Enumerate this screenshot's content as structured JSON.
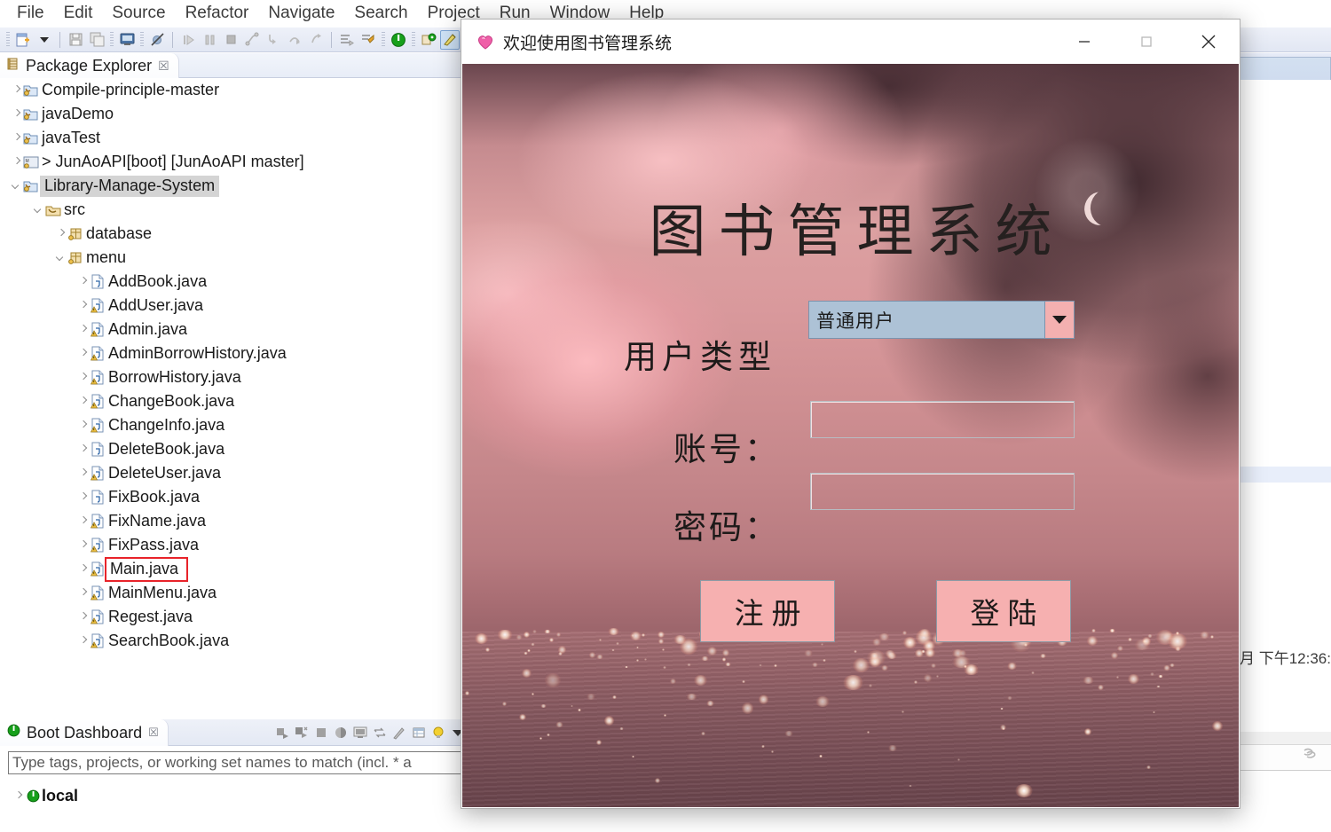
{
  "ide": {
    "menu": [
      "File",
      "Edit",
      "Source",
      "Refactor",
      "Navigate",
      "Search",
      "Project",
      "Run",
      "Window",
      "Help"
    ],
    "package_explorer": {
      "title": "Package Explorer",
      "close_label": "☒",
      "tree": [
        {
          "label": "Compile-principle-master",
          "indent": 0,
          "state": "collapsed",
          "icon": "java-project-icon",
          "selected": false
        },
        {
          "label": "javaDemo",
          "indent": 0,
          "state": "collapsed",
          "icon": "java-project-icon",
          "selected": false
        },
        {
          "label": "javaTest",
          "indent": 0,
          "state": "collapsed",
          "icon": "java-project-icon",
          "selected": false
        },
        {
          "label": "> JunAoAPI ",
          "dim": "[boot] [JunAoAPI master]",
          "indent": 0,
          "state": "collapsed",
          "icon": "maven-project-icon",
          "selected": false
        },
        {
          "label": "Library-Manage-System",
          "indent": 0,
          "state": "expanded",
          "icon": "java-project-icon",
          "selected": true
        },
        {
          "label": "src",
          "indent": 1,
          "state": "expanded",
          "icon": "source-folder-icon",
          "selected": false
        },
        {
          "label": "database",
          "indent": 2,
          "state": "collapsed",
          "icon": "package-icon",
          "selected": false
        },
        {
          "label": "menu",
          "indent": 2,
          "state": "expanded",
          "icon": "package-icon",
          "selected": false
        },
        {
          "label": "AddBook.java",
          "indent": 3,
          "state": "collapsed",
          "icon": "java-file-icon",
          "selected": false
        },
        {
          "label": "AddUser.java",
          "indent": 3,
          "state": "collapsed",
          "icon": "java-file-warning-icon",
          "selected": false
        },
        {
          "label": "Admin.java",
          "indent": 3,
          "state": "collapsed",
          "icon": "java-file-warning-icon",
          "selected": false
        },
        {
          "label": "AdminBorrowHistory.java",
          "indent": 3,
          "state": "collapsed",
          "icon": "java-file-warning-icon",
          "selected": false
        },
        {
          "label": "BorrowHistory.java",
          "indent": 3,
          "state": "collapsed",
          "icon": "java-file-warning-icon",
          "selected": false
        },
        {
          "label": "ChangeBook.java",
          "indent": 3,
          "state": "collapsed",
          "icon": "java-file-warning-icon",
          "selected": false
        },
        {
          "label": "ChangeInfo.java",
          "indent": 3,
          "state": "collapsed",
          "icon": "java-file-warning-icon",
          "selected": false
        },
        {
          "label": "DeleteBook.java",
          "indent": 3,
          "state": "collapsed",
          "icon": "java-file-icon",
          "selected": false
        },
        {
          "label": "DeleteUser.java",
          "indent": 3,
          "state": "collapsed",
          "icon": "java-file-warning-icon",
          "selected": false
        },
        {
          "label": "FixBook.java",
          "indent": 3,
          "state": "collapsed",
          "icon": "java-file-icon",
          "selected": false
        },
        {
          "label": "FixName.java",
          "indent": 3,
          "state": "collapsed",
          "icon": "java-file-warning-icon",
          "selected": false
        },
        {
          "label": "FixPass.java",
          "indent": 3,
          "state": "collapsed",
          "icon": "java-file-warning-icon",
          "selected": false
        },
        {
          "label": "Main.java",
          "indent": 3,
          "state": "collapsed",
          "icon": "java-file-warning-icon",
          "selected": false,
          "highlighted": true
        },
        {
          "label": "MainMenu.java",
          "indent": 3,
          "state": "collapsed",
          "icon": "java-file-warning-icon",
          "selected": false
        },
        {
          "label": "Regest.java",
          "indent": 3,
          "state": "collapsed",
          "icon": "java-file-warning-icon",
          "selected": false
        },
        {
          "label": "SearchBook.java",
          "indent": 3,
          "state": "collapsed",
          "icon": "java-file-warning-icon",
          "selected": false
        }
      ]
    },
    "boot_dashboard": {
      "title": "Boot Dashboard",
      "close_label": "☒",
      "filter_placeholder": "Type tags, projects, or working set names to match (incl. * a",
      "items": [
        {
          "label": "local",
          "state": "collapsed"
        }
      ],
      "toolbar_icons": [
        "start-icon",
        "debug-icon",
        "stop-icon",
        "restart-icon",
        "open-console-icon",
        "request-mapping-icon",
        "edit-icon",
        "properties-icon",
        "lightbulb-icon",
        "view-menu-icon"
      ]
    },
    "editor_timestamp": "月 下午12:36:",
    "highlight_color": "#e8232a"
  },
  "dialog": {
    "window_title": "欢迎使用图书管理系统",
    "title_icon": "pink-heart-icon",
    "minimize_label": "—",
    "maximize_label": "□",
    "close_label": "✕",
    "heading": "图书管理系统",
    "user_type_label": "用户类型",
    "user_type_value": "普通用户",
    "account_label": "账号：",
    "account_value": "",
    "password_label": "密码：",
    "password_value": "",
    "register_button": "注册",
    "login_button": "登陆",
    "colors": {
      "button_pink": "#f6b0b0",
      "combo_blue": "#adc2d6",
      "combo_arrow_pink": "#f4b0b0"
    }
  }
}
